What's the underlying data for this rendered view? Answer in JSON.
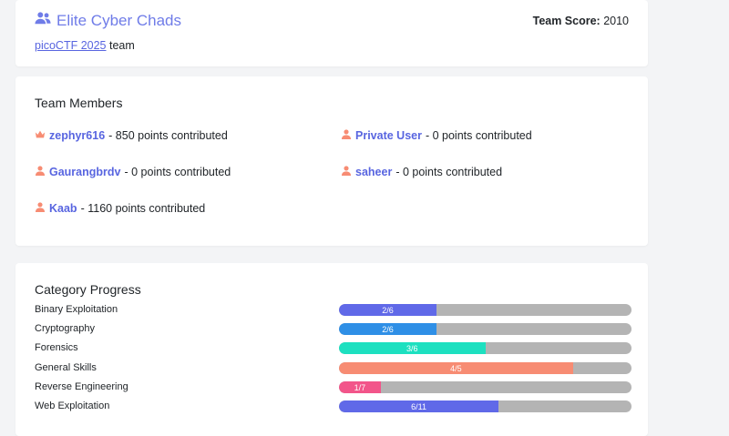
{
  "team": {
    "name": "Elite Cyber Chads",
    "event_link": "picoCTF 2025",
    "event_suffix": " team",
    "score_label": "Team Score:",
    "score_value": " 2010"
  },
  "members_section": {
    "heading": "Team Members",
    "members": [
      {
        "name": "zephyr616",
        "suffix": " - 850 points contributed",
        "icon": "crown-icon"
      },
      {
        "name": "Private User",
        "suffix": " - 0 points contributed",
        "icon": "user-icon"
      },
      {
        "name": "Gaurangbrdv",
        "suffix": " - 0 points contributed",
        "icon": "user-icon"
      },
      {
        "name": "saheer",
        "suffix": " - 0 points contributed",
        "icon": "user-icon"
      },
      {
        "name": "Kaab",
        "suffix": " - 1160 points contributed",
        "icon": "user-icon"
      }
    ]
  },
  "progress_section": {
    "heading": "Category Progress",
    "categories": [
      {
        "name": "Binary Exploitation",
        "label": "2/6",
        "solved": 2,
        "total": 6,
        "color": "#6069e8"
      },
      {
        "name": "Cryptography",
        "label": "2/6",
        "solved": 2,
        "total": 6,
        "color": "#2f8fe6"
      },
      {
        "name": "Forensics",
        "label": "3/6",
        "solved": 3,
        "total": 6,
        "color": "#1de0c0"
      },
      {
        "name": "General Skills",
        "label": "4/5",
        "solved": 4,
        "total": 5,
        "color": "#f78c73"
      },
      {
        "name": "Reverse Engineering",
        "label": "1/7",
        "solved": 1,
        "total": 7,
        "color": "#f2558a"
      },
      {
        "name": "Web Exploitation",
        "label": "6/11",
        "solved": 6,
        "total": 11,
        "color": "#6069e8"
      }
    ]
  },
  "colors": {
    "accent": "#5865e0",
    "icon_user": "#f78c73",
    "bar_track": "#b4b4b4"
  }
}
